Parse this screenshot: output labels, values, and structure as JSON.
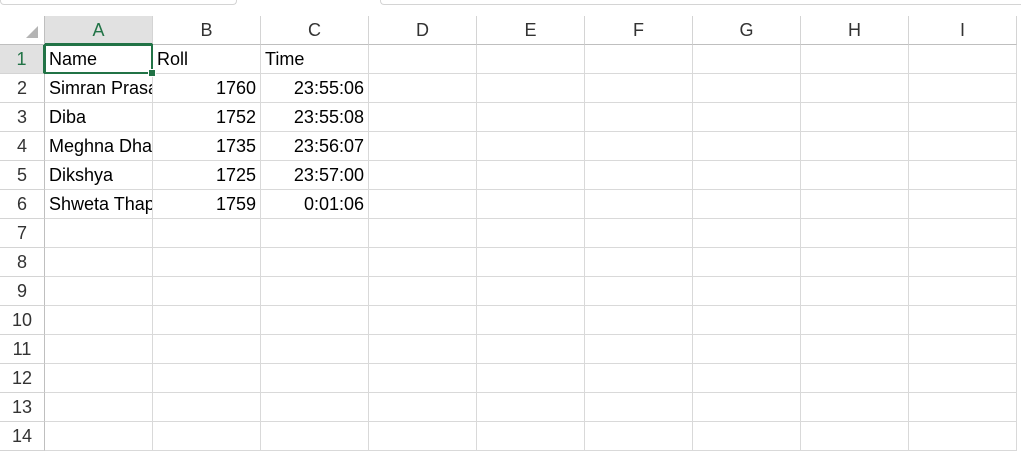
{
  "columns": [
    "A",
    "B",
    "C",
    "D",
    "E",
    "F",
    "G",
    "H",
    "I"
  ],
  "rows": [
    "1",
    "2",
    "3",
    "4",
    "5",
    "6",
    "7",
    "8",
    "9",
    "10",
    "11",
    "12",
    "13",
    "14"
  ],
  "active_cell": "A1",
  "selection_color": "#217346",
  "cells": {
    "A1": "Name",
    "B1": "Roll",
    "C1": "Time",
    "A2": "Simran Prasad",
    "B2": "1760",
    "C2": "23:55:06",
    "A3": "Diba",
    "B3": "1752",
    "C3": "23:55:08",
    "A4": "Meghna Dhakal",
    "B4": "1735",
    "C4": "23:56:07",
    "A5": "Dikshya",
    "B5": "1725",
    "C5": "23:57:00",
    "A6": "Shweta Thapa",
    "B6": "1759",
    "C6": "0:01:06"
  }
}
